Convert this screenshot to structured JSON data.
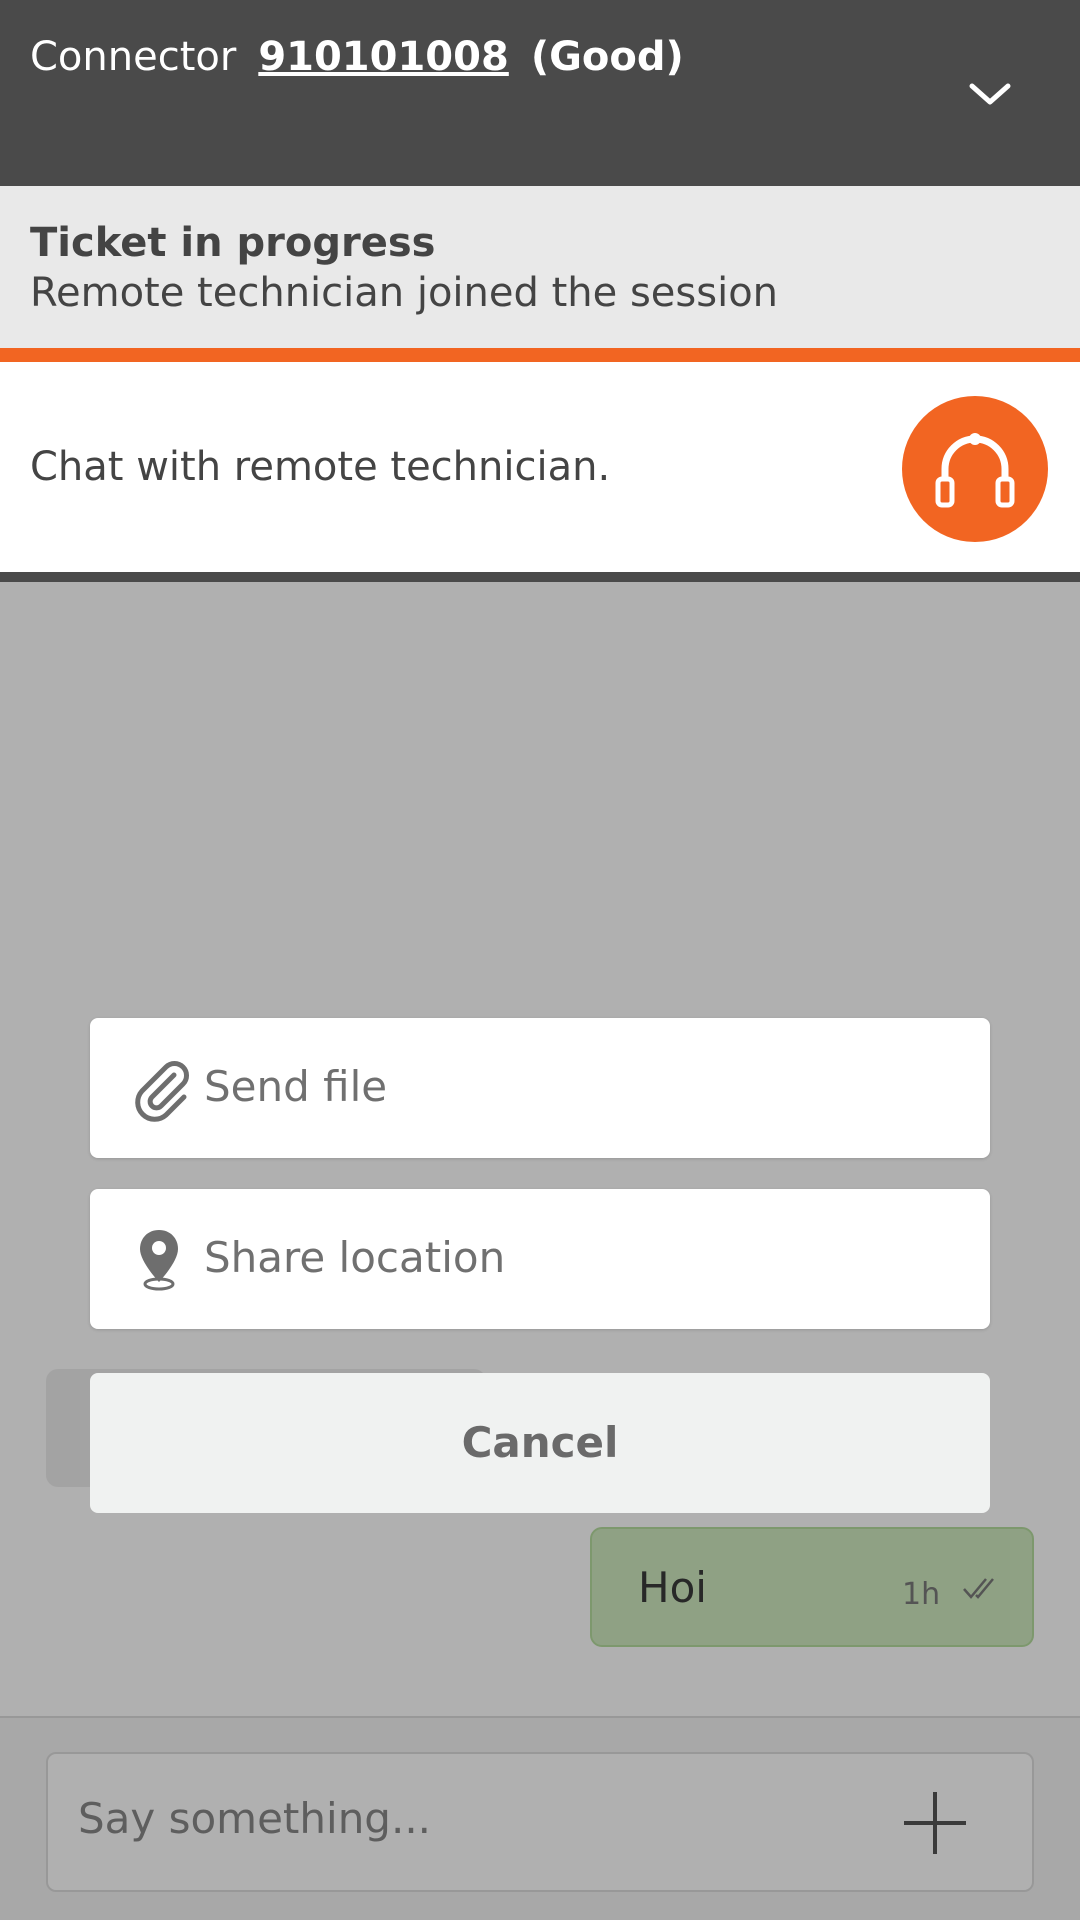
{
  "header": {
    "connector_label": "Connector",
    "connector_id": "910101008",
    "connector_status": "(Good)"
  },
  "ticket": {
    "title": "Ticket in progress",
    "subtitle": "Remote technician joined the session"
  },
  "chat_banner": {
    "text": "Chat with remote technician."
  },
  "messages": [
    {
      "text": "Hoi",
      "time": "1h",
      "status_icon": "double-check-icon"
    }
  ],
  "composer": {
    "placeholder": "Say something..."
  },
  "action_sheet": {
    "send_file": "Send file",
    "share_location": "Share location",
    "cancel": "Cancel"
  },
  "colors": {
    "header_bg": "#4a4a4a",
    "accent": "#f26522",
    "ticket_bg": "#e9e9e9",
    "outgoing_bubble": "#cfeac0"
  }
}
